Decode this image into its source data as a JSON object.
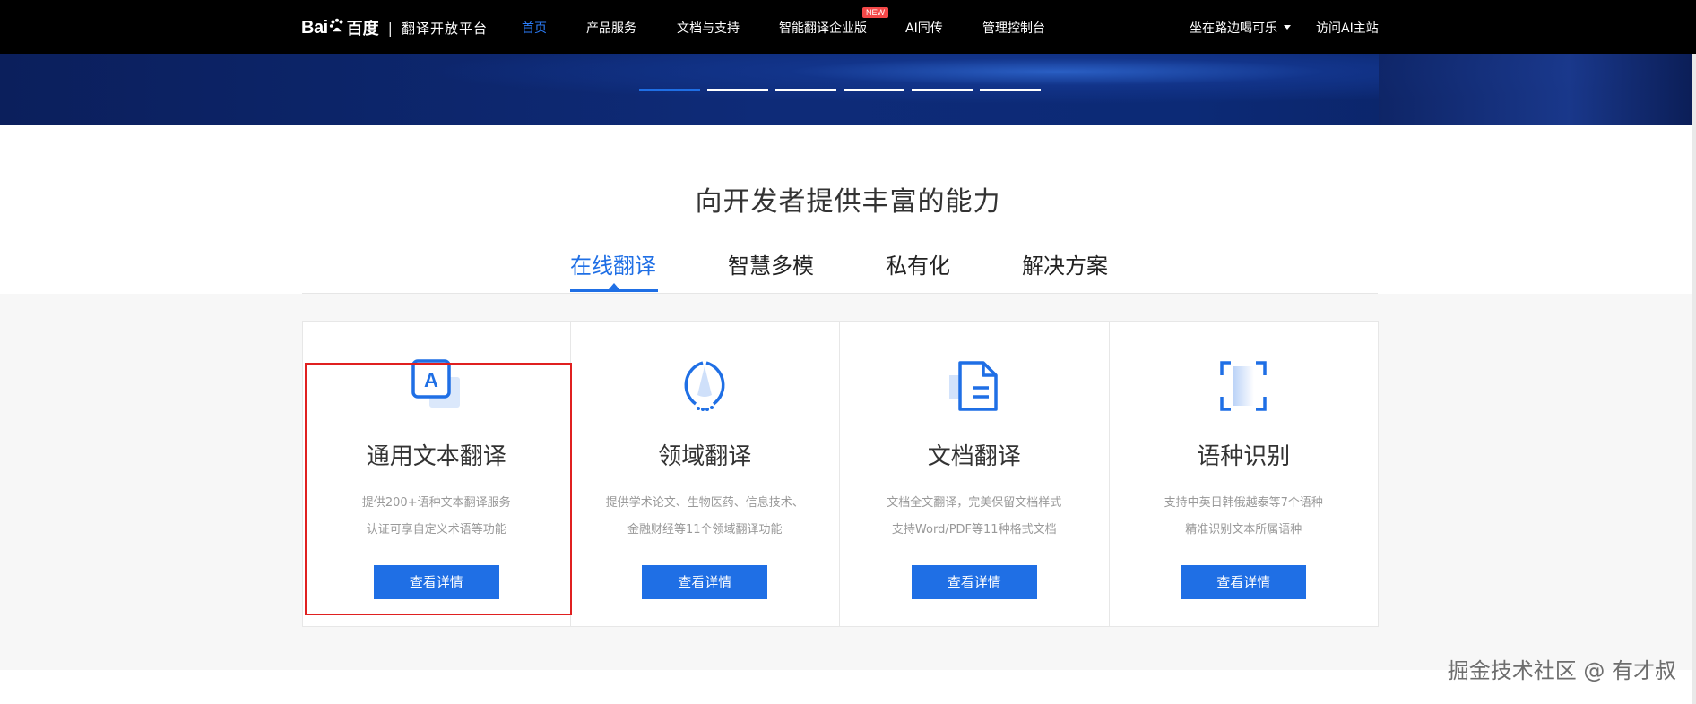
{
  "nav": {
    "logo_bai": "Bai",
    "logo_du": "百度",
    "logo_sep": "|",
    "platform": "翻译开放平台",
    "items": [
      {
        "label": "首页",
        "active": true
      },
      {
        "label": "产品服务"
      },
      {
        "label": "文档与支持"
      },
      {
        "label": "智能翻译企业版",
        "badge": "NEW"
      },
      {
        "label": "AI同传"
      },
      {
        "label": "管理控制台"
      }
    ],
    "user": "坐在路边喝可乐",
    "visit": "访问AI主站"
  },
  "banner": {
    "carousel_count": 6,
    "active_index": 0
  },
  "section": {
    "title": "向开发者提供丰富的能力",
    "tabs": [
      {
        "label": "在线翻译",
        "active": true
      },
      {
        "label": "智慧多模"
      },
      {
        "label": "私有化"
      },
      {
        "label": "解决方案"
      }
    ]
  },
  "cards": [
    {
      "icon": "text-a-icon",
      "title": "通用文本翻译",
      "desc1": "提供200+语种文本翻译服务",
      "desc2": "认证可享自定义术语等功能",
      "button": "查看详情"
    },
    {
      "icon": "domain-circle-icon",
      "title": "领域翻译",
      "desc1": "提供学术论文、生物医药、信息技术、",
      "desc2": "金融财经等11个领域翻译功能",
      "button": "查看详情"
    },
    {
      "icon": "document-icon",
      "title": "文档翻译",
      "desc1": "文档全文翻译，完美保留文档样式",
      "desc2": "支持Word/PDF等11种格式文档",
      "button": "查看详情"
    },
    {
      "icon": "scan-frame-icon",
      "title": "语种识别",
      "desc1": "支持中英日韩俄越泰等7个语种",
      "desc2": "精准识别文本所属语种",
      "button": "查看详情"
    }
  ],
  "watermark": "掘金技术社区 @ 有才叔",
  "colors": {
    "accent": "#1f6fe5",
    "nav_bg": "#000000",
    "highlight": "#e02020"
  }
}
